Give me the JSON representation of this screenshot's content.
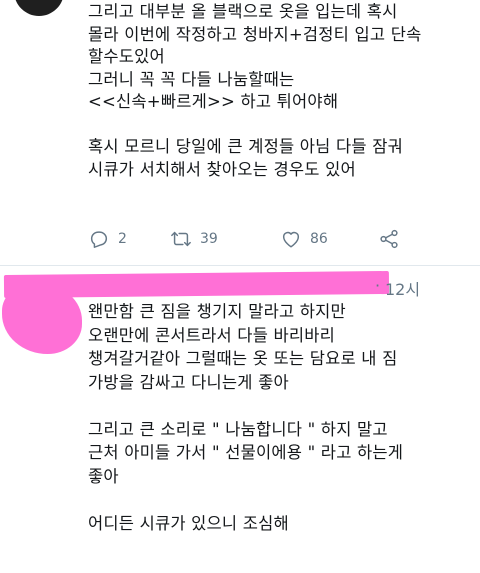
{
  "tweet1": {
    "lines": [
      "그리고 대부분 올 블랙으로 옷을 입는데 혹시",
      "몰라 이번에 작정하고 청바지+검정티 입고 단속",
      "할수도있어",
      "그러니 꼭 꼭 다들 나눔할때는",
      "<<신속+빠르게>> 하고 튀어야해",
      "",
      "혹시 모르니 당일에 큰 계정들 아님 다들 잠궈",
      "시큐가 서치해서 찾아오는 경우도 있어"
    ],
    "reply_count": "2",
    "retweet_count": "39",
    "like_count": "86",
    "icons": {
      "reply": "reply-icon",
      "retweet": "retweet-icon",
      "like": "heart-icon",
      "share": "share-icon"
    }
  },
  "tweet2": {
    "separator": "·",
    "time": "12시",
    "lines": [
      "왠만함 큰 짐을 챙기지 말라고 하지만",
      "오랜만에 콘서트라서 다들 바리바리",
      "챙겨갈거같아 그럴때는 옷 또는 담요로 내 짐",
      "가방을 감싸고 다니는게 좋아",
      "",
      "그리고 큰 소리로 \" 나눔합니다 \" 하지 말고",
      "근처 아미들 가서 \" 선물이에용 \" 라고 하는게",
      "좋아",
      "",
      "어디든 시큐가 있으니 조심해"
    ],
    "redaction_color": "#ff70d6"
  },
  "colors": {
    "text": "#14171a",
    "secondary": "#657786",
    "divider": "#e1e8ed"
  }
}
